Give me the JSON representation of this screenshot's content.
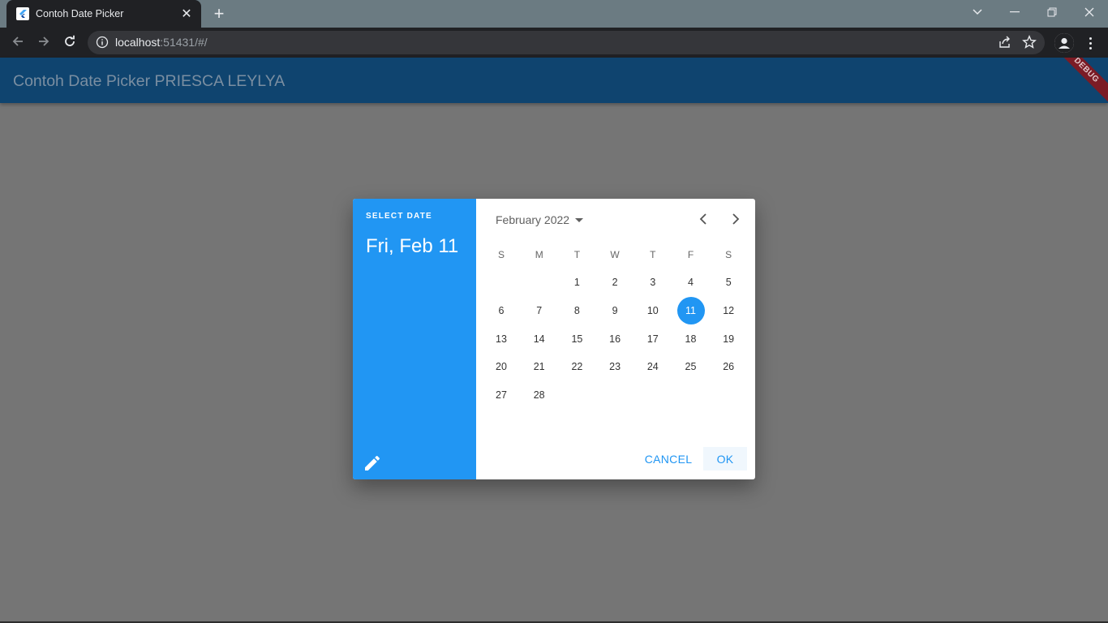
{
  "browser": {
    "tab_title": "Contoh Date Picker",
    "url_host": "localhost",
    "url_rest": ":51431/#/"
  },
  "app": {
    "title": "Contoh Date Picker PRIESCA LEYLYA",
    "debug_banner": "DEBUG"
  },
  "date_picker": {
    "help_text": "SELECT DATE",
    "selected_date": "Fri, Feb 11",
    "month_year": "February 2022",
    "weekdays": [
      "S",
      "M",
      "T",
      "W",
      "T",
      "F",
      "S"
    ],
    "days": [
      "1",
      "2",
      "3",
      "4",
      "5",
      "6",
      "7",
      "8",
      "9",
      "10",
      "11",
      "12",
      "13",
      "14",
      "15",
      "16",
      "17",
      "18",
      "19",
      "20",
      "21",
      "22",
      "23",
      "24",
      "25",
      "26",
      "27",
      "28"
    ],
    "first_weekday_index": 2,
    "selected_day": "11",
    "cancel_label": "CANCEL",
    "ok_label": "OK",
    "accent_color": "#2196f3"
  },
  "icons": {
    "favicon": "flutter-icon",
    "back": "arrow-left-icon",
    "forward": "arrow-right-icon",
    "reload": "reload-icon",
    "info": "info-icon",
    "share": "share-icon",
    "bookmark": "star-icon",
    "profile": "profile-icon",
    "menu": "kebab-menu-icon",
    "edit": "pencil-icon",
    "prev_month": "chevron-left-icon",
    "next_month": "chevron-right-icon",
    "month_dropdown": "caret-down-icon"
  }
}
